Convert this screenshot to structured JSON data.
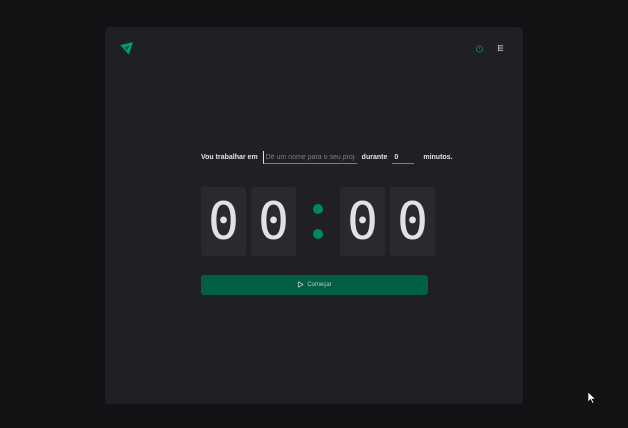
{
  "header": {
    "logo_icon": "timer-logo-icon",
    "nav_icons": [
      "timer-icon",
      "history-icon"
    ],
    "accent_color": "#00875f"
  },
  "form": {
    "task_label": "Vou trabalhar em",
    "task_placeholder": "Dê um nome para o seu projeto",
    "task_value": "",
    "duration_label": "durante",
    "minutes_value": "0",
    "minutes_suffix": "minutos."
  },
  "countdown": {
    "minutes_tens": "0",
    "minutes_ones": "0",
    "seconds_tens": "0",
    "seconds_ones": "0"
  },
  "start_button": {
    "label": "Começar",
    "icon": "play-icon",
    "color": "#015f43"
  }
}
